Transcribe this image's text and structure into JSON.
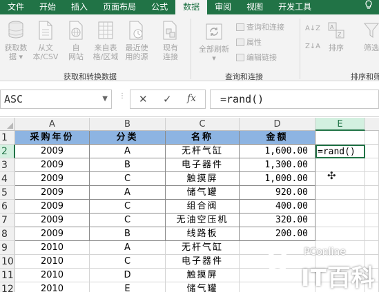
{
  "ribbon": {
    "tabs": [
      "文件",
      "开始",
      "插入",
      "页面布局",
      "公式",
      "数据",
      "审阅",
      "视图",
      "开发工具"
    ],
    "active_tab": "数据",
    "help_icon": "lightbulb-icon",
    "get_data": {
      "buttons": [
        {
          "label1": "获取数",
          "label2": "据 ▾",
          "icon": "database-icon"
        },
        {
          "label1": "从文",
          "label2": "本/CSV",
          "icon": "text-file-icon"
        },
        {
          "label1": "自",
          "label2": "网站",
          "icon": "web-icon"
        },
        {
          "label1": "来自表",
          "label2": "格/区域",
          "icon": "table-icon"
        },
        {
          "label1": "最近使",
          "label2": "用的源",
          "icon": "recent-sources-icon"
        },
        {
          "label1": "现有",
          "label2": "连接",
          "icon": "existing-connections-icon"
        }
      ],
      "group_label": "获取和转换数据"
    },
    "queries": {
      "refresh_label1": "全部刷新",
      "refresh_label2": "▾",
      "items": [
        "查询和连接",
        "属性",
        "编辑链接"
      ],
      "group_label": "查询和连接"
    },
    "sort": {
      "az_label": "A↓Z",
      "za_label": "Z↓A",
      "sort_label": "排序",
      "filter_label": "筛选",
      "group_label": "排序和筛"
    }
  },
  "formula_bar": {
    "name_box": "ASC",
    "cancel_icon": "✕",
    "enter_icon": "✓",
    "fx_label": "fx",
    "formula": "=rand()"
  },
  "sheet": {
    "columns": [
      "A",
      "B",
      "C",
      "D",
      "E"
    ],
    "selected_column": "E",
    "selected_row": 2,
    "row_numbers": [
      "1",
      "2",
      "3",
      "4",
      "5",
      "6",
      "7",
      "8",
      "9",
      "10",
      "11",
      "12"
    ],
    "header": [
      "采购年份",
      "分类",
      "名称",
      "金额"
    ],
    "rows": [
      [
        "2009",
        "A",
        "无杆气缸",
        "1,600.00"
      ],
      [
        "2009",
        "B",
        "电子器件",
        "1,300.00"
      ],
      [
        "2009",
        "C",
        "触摸屏",
        "1,000.00"
      ],
      [
        "2009",
        "A",
        "储气罐",
        "920.00"
      ],
      [
        "2009",
        "C",
        "组合阀",
        "400.00"
      ],
      [
        "2009",
        "C",
        "无油空压机",
        "320.00"
      ],
      [
        "2009",
        "B",
        "线路板",
        "200.00"
      ],
      [
        "2010",
        "A",
        "无杆气缸",
        ""
      ],
      [
        "2010",
        "C",
        "电子器件",
        ""
      ],
      [
        "2010",
        "D",
        "触摸屏",
        ""
      ],
      [
        "2010",
        "E",
        "储气罐",
        ""
      ]
    ],
    "active_cell_value": "=rand()"
  },
  "watermark": {
    "brand": "PConline",
    "logo_text": "IT百科"
  }
}
